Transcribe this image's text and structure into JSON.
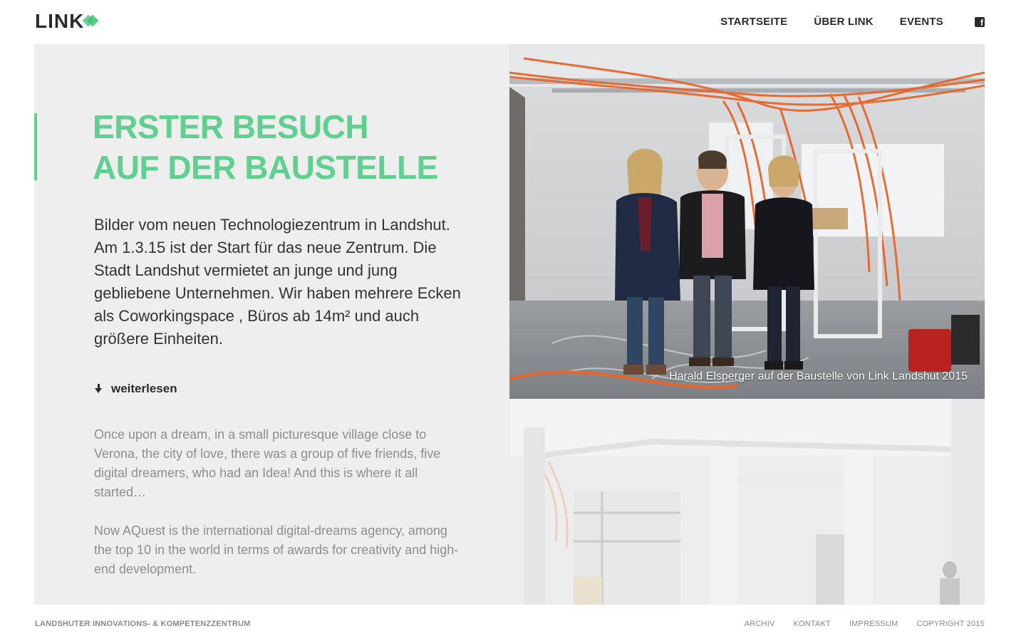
{
  "brand": {
    "logo_text": "LINK",
    "accent_color": "#5fd08f"
  },
  "nav": {
    "items": [
      {
        "label": "STARTSEITE"
      },
      {
        "label": "ÜBER LINK"
      },
      {
        "label": "EVENTS"
      }
    ],
    "social_icon": "facebook-icon"
  },
  "article": {
    "title_line1": "ERSTER BESUCH",
    "title_line2": "AUF DER BAUSTELLE",
    "lead": "Bilder vom neuen Technologiezentrum in Landshut. Am 1.3.15 ist der Start für das neue Zentrum. Die Stadt Landshut vermietet an junge und jung gebliebene Unternehmen. Wir haben mehrere Ecken als  Coworkingspace , Büros ab 14m² und auch größere Einheiten.",
    "read_more": "weiterlesen",
    "paragraph1": "Once upon a dream, in a small picturesque village close to Verona, the city of love, there was a group of five friends, five digital dreamers, who had an Idea! And this is where it all started…",
    "paragraph2": "Now AQuest is the international digital-dreams agency, among the top 10 in the world in terms of awards for creativity and high-end development."
  },
  "photos": {
    "caption1": "Harald Elsperger auf der Baustelle von Link Landshut 2015"
  },
  "footer": {
    "tagline": "LANDSHUTER INNOVATIONS- & KOMPETENZZENTRUM",
    "links": [
      {
        "label": "ARCHIV"
      },
      {
        "label": "KONTAKT"
      },
      {
        "label": "IMPRESSUM"
      }
    ],
    "copyright": "COPYRIGHT 2015"
  }
}
